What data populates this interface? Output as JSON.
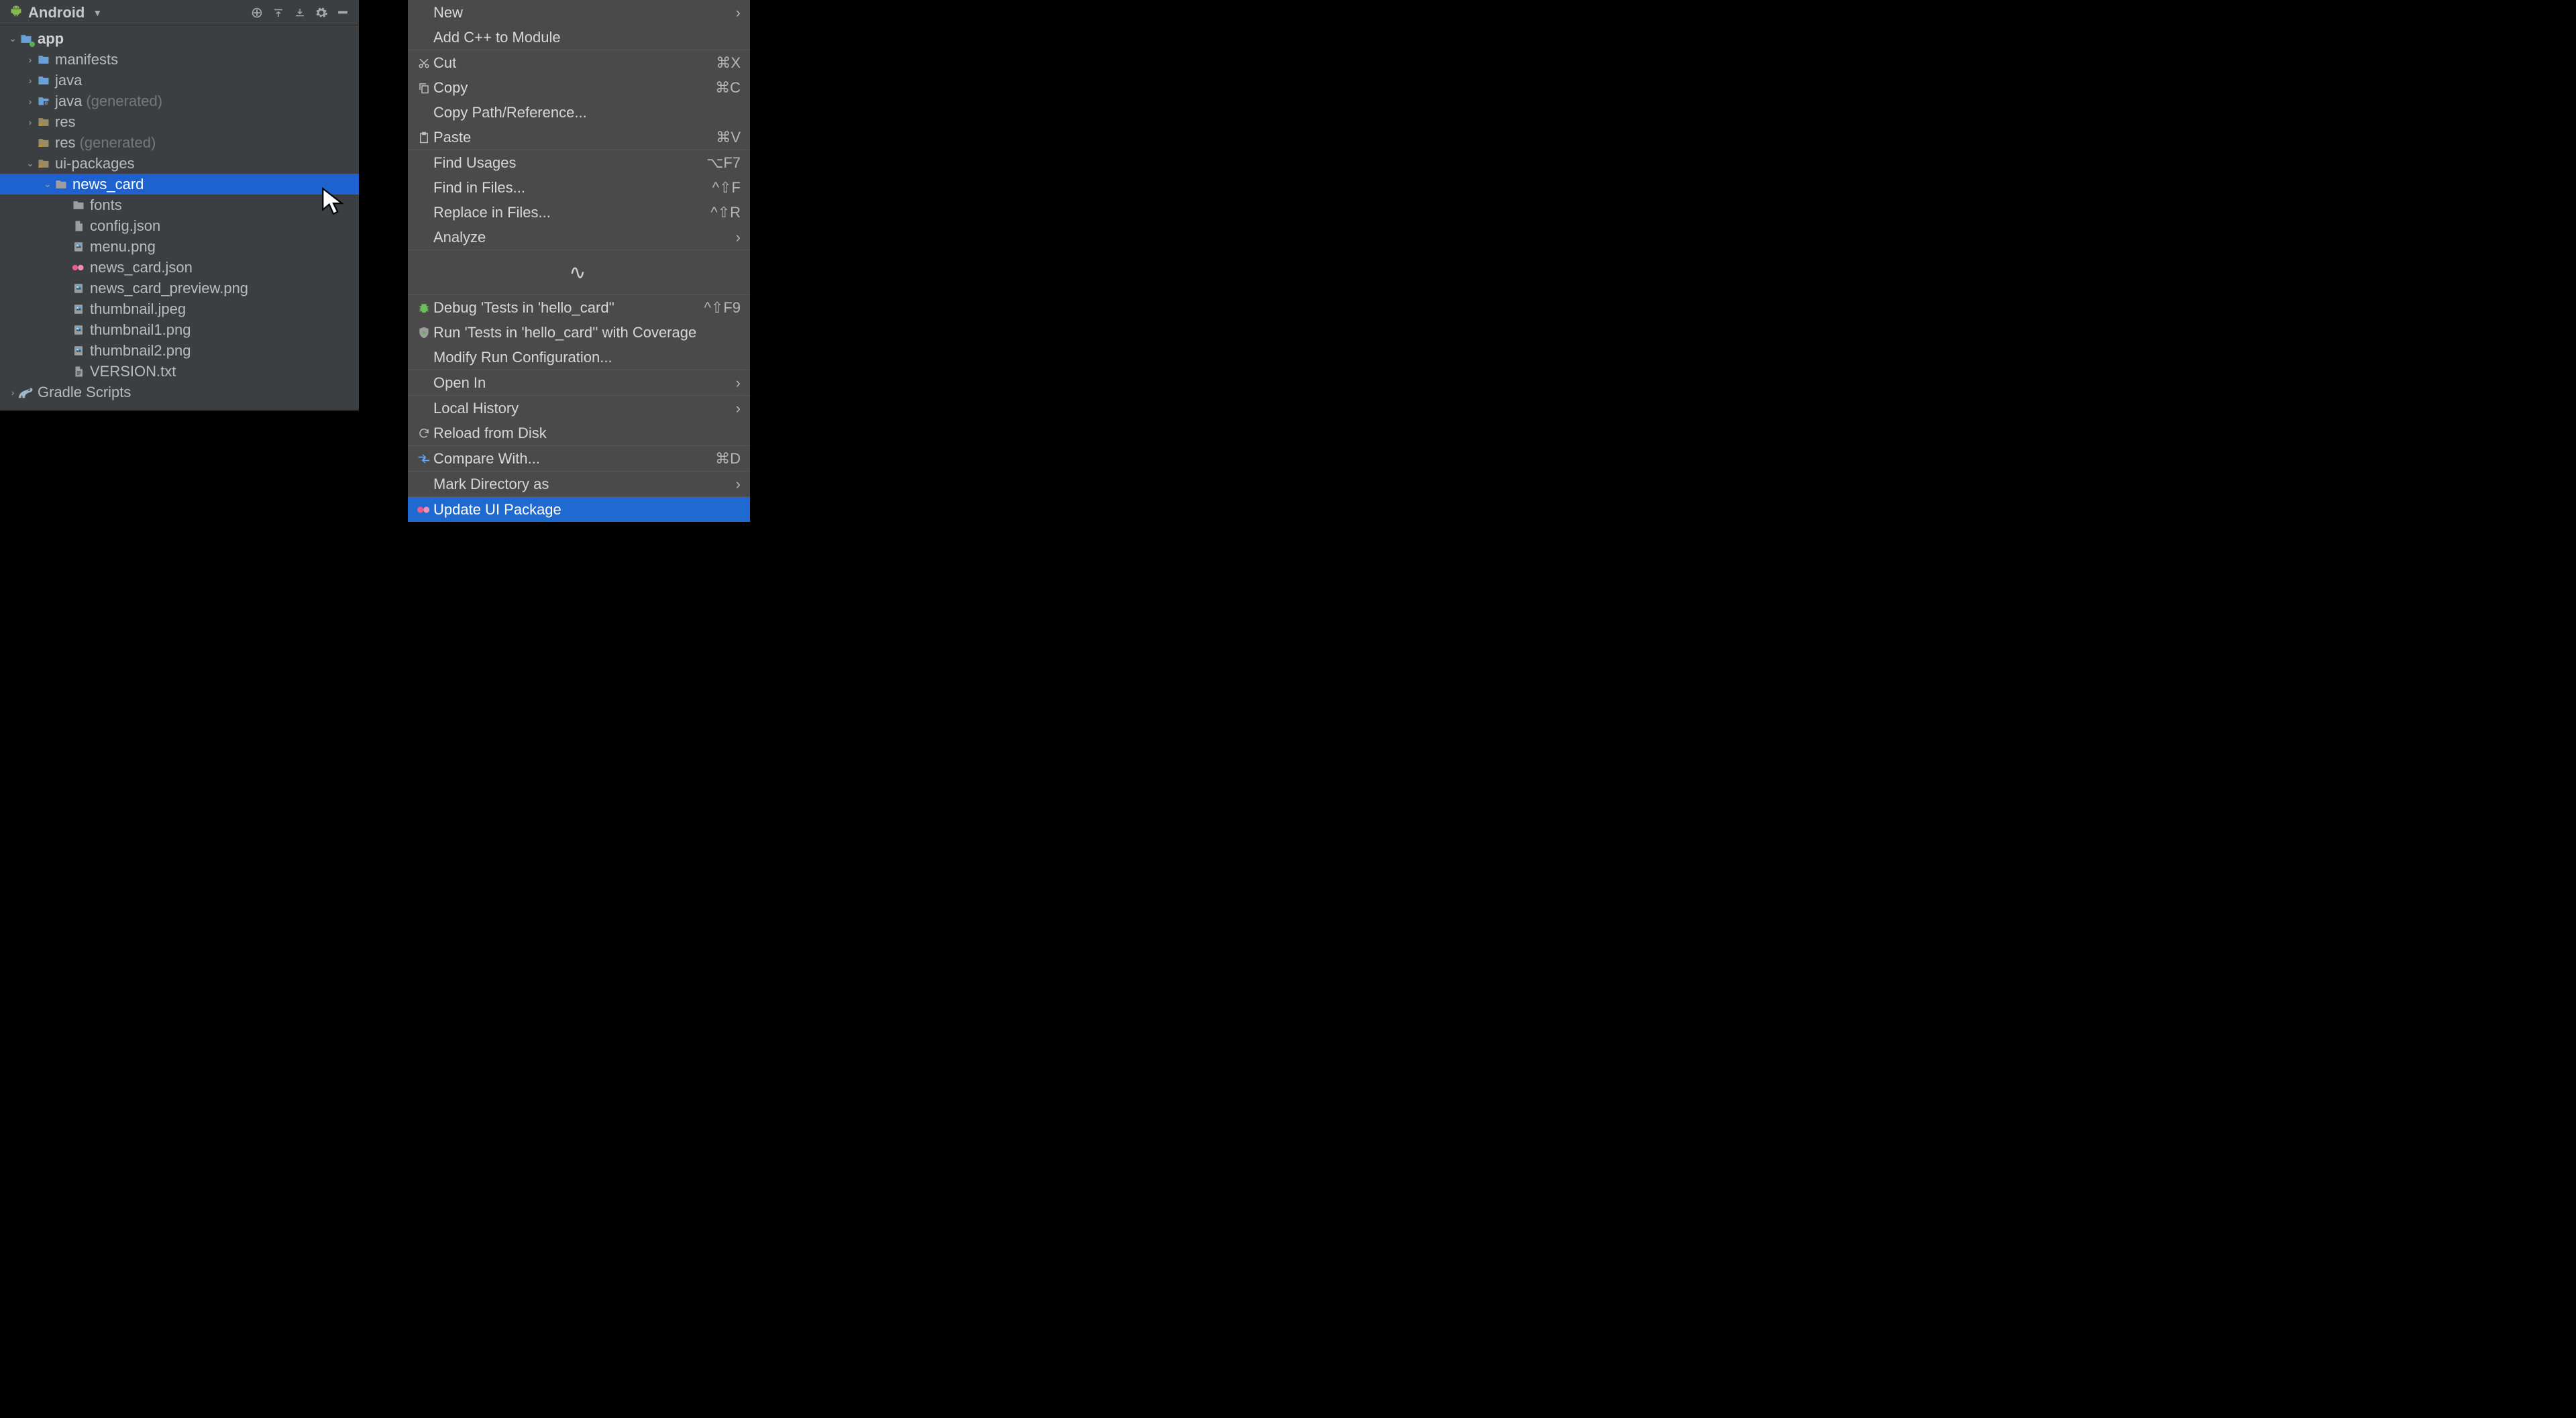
{
  "panel": {
    "title": "Android"
  },
  "tree": [
    {
      "id": "app",
      "label": "app",
      "depth": 0,
      "caret": "down",
      "icon": "module",
      "bold": true
    },
    {
      "id": "manifests",
      "label": "manifests",
      "depth": 1,
      "caret": "right",
      "icon": "folder-blue"
    },
    {
      "id": "java",
      "label": "java",
      "depth": 1,
      "caret": "right",
      "icon": "folder-blue"
    },
    {
      "id": "javagen",
      "label": "java",
      "depth": 1,
      "caret": "right",
      "icon": "folder-gen",
      "muted": "(generated)"
    },
    {
      "id": "res",
      "label": "res",
      "depth": 1,
      "caret": "right",
      "icon": "folder-res"
    },
    {
      "id": "resgen",
      "label": "res",
      "depth": 1,
      "caret": "none",
      "icon": "folder-res",
      "muted": "(generated)"
    },
    {
      "id": "uipkg",
      "label": "ui-packages",
      "depth": 1,
      "caret": "down",
      "icon": "folder-res"
    },
    {
      "id": "newscard",
      "label": "news_card",
      "depth": 2,
      "caret": "down",
      "icon": "folder-grey",
      "selected": true
    },
    {
      "id": "fonts",
      "label": "fonts",
      "depth": 3,
      "caret": "none",
      "icon": "folder-grey"
    },
    {
      "id": "config",
      "label": "config.json",
      "depth": 3,
      "caret": "none",
      "icon": "file-json"
    },
    {
      "id": "menu",
      "label": "menu.png",
      "depth": 3,
      "caret": "none",
      "icon": "file-img"
    },
    {
      "id": "ncjson",
      "label": "news_card.json",
      "depth": 3,
      "caret": "none",
      "icon": "file-relay"
    },
    {
      "id": "ncprev",
      "label": "news_card_preview.png",
      "depth": 3,
      "caret": "none",
      "icon": "file-img"
    },
    {
      "id": "thumb",
      "label": "thumbnail.jpeg",
      "depth": 3,
      "caret": "none",
      "icon": "file-img"
    },
    {
      "id": "thumb1",
      "label": "thumbnail1.png",
      "depth": 3,
      "caret": "none",
      "icon": "file-img"
    },
    {
      "id": "thumb2",
      "label": "thumbnail2.png",
      "depth": 3,
      "caret": "none",
      "icon": "file-img"
    },
    {
      "id": "ver",
      "label": "VERSION.txt",
      "depth": 3,
      "caret": "none",
      "icon": "file-txt"
    },
    {
      "id": "gradle",
      "label": "Gradle Scripts",
      "depth": 0,
      "caret": "right",
      "icon": "gradle"
    }
  ],
  "menu": [
    {
      "type": "item",
      "id": "new",
      "label": "New",
      "arrow": true
    },
    {
      "type": "item",
      "id": "addcpp",
      "label": "Add C++ to Module"
    },
    {
      "type": "sep"
    },
    {
      "type": "item",
      "id": "cut",
      "label": "Cut",
      "icon": "cut",
      "shortcut": "⌘X"
    },
    {
      "type": "item",
      "id": "copy",
      "label": "Copy",
      "icon": "copy",
      "shortcut": "⌘C"
    },
    {
      "type": "item",
      "id": "copypath",
      "label": "Copy Path/Reference..."
    },
    {
      "type": "item",
      "id": "paste",
      "label": "Paste",
      "icon": "paste",
      "shortcut": "⌘V"
    },
    {
      "type": "sep"
    },
    {
      "type": "item",
      "id": "findusg",
      "label": "Find Usages",
      "shortcut": "⌥F7"
    },
    {
      "type": "item",
      "id": "findfiles",
      "label": "Find in Files...",
      "shortcut": "^⇧F"
    },
    {
      "type": "item",
      "id": "replace",
      "label": "Replace in Files...",
      "shortcut": "^⇧R"
    },
    {
      "type": "item",
      "id": "analyze",
      "label": "Analyze",
      "arrow": true
    },
    {
      "type": "sep"
    },
    {
      "type": "loading"
    },
    {
      "type": "sep"
    },
    {
      "type": "item",
      "id": "debug",
      "label": "Debug 'Tests in 'hello_card''",
      "icon": "bug",
      "shortcut": "^⇧F9"
    },
    {
      "type": "item",
      "id": "coverage",
      "label": "Run 'Tests in 'hello_card'' with Coverage",
      "icon": "coverage"
    },
    {
      "type": "item",
      "id": "modrun",
      "label": "Modify Run Configuration..."
    },
    {
      "type": "sep"
    },
    {
      "type": "item",
      "id": "openin",
      "label": "Open In",
      "arrow": true
    },
    {
      "type": "sep"
    },
    {
      "type": "item",
      "id": "localhist",
      "label": "Local History",
      "arrow": true
    },
    {
      "type": "item",
      "id": "reload",
      "label": "Reload from Disk",
      "icon": "reload"
    },
    {
      "type": "sep"
    },
    {
      "type": "item",
      "id": "compare",
      "label": "Compare With...",
      "icon": "compare",
      "shortcut": "⌘D"
    },
    {
      "type": "sep"
    },
    {
      "type": "item",
      "id": "markdir",
      "label": "Mark Directory as",
      "arrow": true
    },
    {
      "type": "sep"
    },
    {
      "type": "item",
      "id": "update",
      "label": "Update UI Package",
      "icon": "relay",
      "selected": true
    }
  ]
}
